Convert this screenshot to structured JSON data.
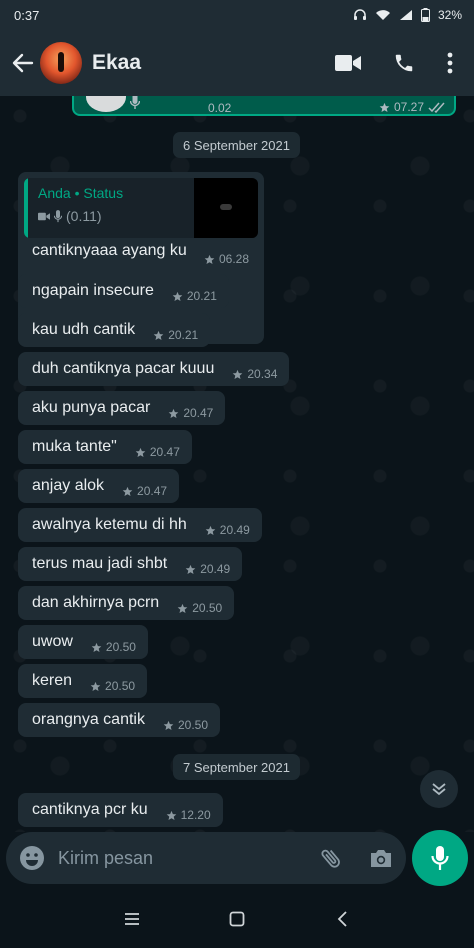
{
  "status_bar": {
    "time": "0:37",
    "battery": "32%"
  },
  "header": {
    "contact_name": "Ekaa"
  },
  "previous_message": {
    "duration": "0.02",
    "time": "07.27"
  },
  "date_chips": [
    "6 September 2021",
    "7 September 2021"
  ],
  "reply": {
    "quote_title": "Anda • Status",
    "quote_sub": "(0.11)",
    "text": "cantiknyaaa ayang ku",
    "time": "06.28"
  },
  "messages": [
    {
      "text": "ngapain insecure",
      "time": "20.21"
    },
    {
      "text": "kau udh cantik",
      "time": "20.21"
    },
    {
      "text": "duh cantiknya pacar kuuu",
      "time": "20.34"
    },
    {
      "text": "aku punya pacar",
      "time": "20.47"
    },
    {
      "text": "muka tante\"",
      "time": "20.47"
    },
    {
      "text": "anjay alok",
      "time": "20.47"
    },
    {
      "text": "awalnya ketemu di hh",
      "time": "20.49"
    },
    {
      "text": "terus mau jadi shbt",
      "time": "20.49"
    },
    {
      "text": "dan akhirnya pcrn",
      "time": "20.50"
    },
    {
      "text": "uwow",
      "time": "20.50"
    },
    {
      "text": "keren",
      "time": "20.50"
    },
    {
      "text": "orangnya cantik",
      "time": "20.50"
    },
    {
      "text": "cantiknya pcr ku",
      "time": "12.20"
    }
  ],
  "composer": {
    "placeholder": "Kirim pesan"
  },
  "colors": {
    "accent": "#00a884",
    "header": "#1f2c34",
    "bubble_in": "#1f2c34",
    "background": "#0b141a"
  }
}
